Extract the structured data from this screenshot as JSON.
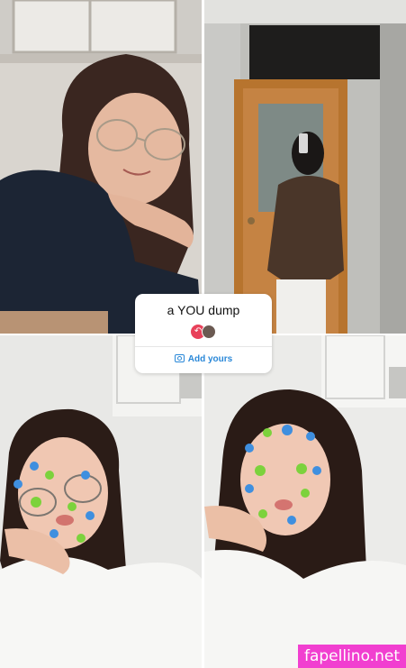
{
  "collage": {
    "photos": [
      {
        "id": "top-left",
        "subject": "selfie-glasses-navy-top"
      },
      {
        "id": "top-right",
        "subject": "mirror-selfie-brown-blazer"
      },
      {
        "id": "bottom-left",
        "subject": "selfie-face-stickers"
      },
      {
        "id": "bottom-right",
        "subject": "selfie-face-stickers"
      }
    ]
  },
  "sticker": {
    "title": "a YOU dump",
    "action_label": "Add yours",
    "avatar_icon": "↶",
    "action_icon": "camera-icon",
    "action_color": "#2a88d8"
  },
  "watermark": {
    "text": "fapellino.net",
    "color": "#f13fd0"
  }
}
